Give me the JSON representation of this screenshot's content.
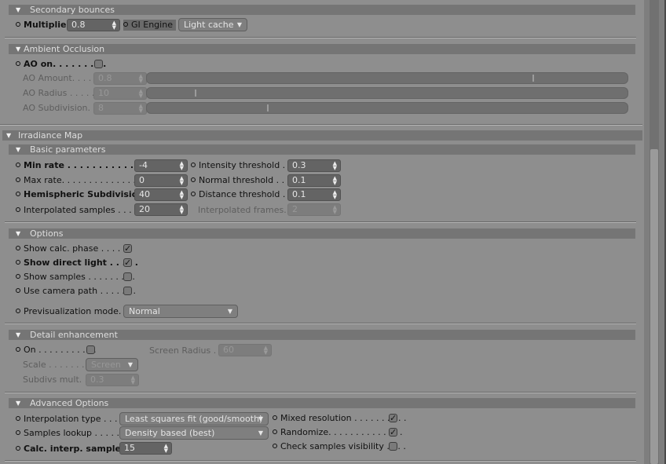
{
  "secondary_bounces": {
    "header": "Secondary bounces",
    "multiplier_label": "Multiplier",
    "multiplier_value": "0.8",
    "gi_engine_label": "GI Engine",
    "gi_engine_value": "Light cache"
  },
  "ambient_occlusion": {
    "header": "Ambient Occlusion",
    "ao_on_label": "AO on. . . . . . . . .",
    "ao_on_checked": false,
    "ao_amount_label": "AO Amount. . . . .",
    "ao_amount_value": "0.8",
    "ao_amount_slider": 0.8,
    "ao_radius_label": "AO Radius . . . . .",
    "ao_radius_value": "10",
    "ao_radius_slider": 0.1,
    "ao_subdivision_label": "AO Subdivision. . .",
    "ao_subdivision_value": "8",
    "ao_subdivision_slider": 0.25
  },
  "irradiance_map": {
    "header": "Irradiance Map",
    "basic": {
      "header": "Basic parameters",
      "min_rate_label": "Min rate . . . . . . . . . . . . . .",
      "min_rate_value": "-4",
      "max_rate_label": "Max rate. . . . . . . . . . . . . . .",
      "max_rate_value": "0",
      "hemi_label": "Hemispheric Subdivision",
      "hemi_value": "40",
      "interp_samples_label": "Interpolated samples . . . . . .",
      "interp_samples_value": "20",
      "intensity_label": "Intensity threshold . . .",
      "intensity_value": "0.3",
      "normal_label": "Normal threshold . . . .",
      "normal_value": "0.1",
      "distance_label": "Distance threshold . . .",
      "distance_value": "0.1",
      "interp_frames_label": "Interpolated frames. . .",
      "interp_frames_value": "2"
    },
    "options": {
      "header": "Options",
      "show_calc_label": "Show calc. phase . . . . . .",
      "show_calc_checked": true,
      "show_direct_label": "Show direct light . . . . .",
      "show_direct_checked": true,
      "show_samples_label": "Show samples . . . . . . . . .",
      "show_samples_checked": false,
      "camera_path_label": "Use camera path . . . . . . .",
      "camera_path_checked": false,
      "previs_label": "Previsualization mode. . . .",
      "previs_value": "Normal"
    },
    "detail": {
      "header": "Detail enhancement",
      "on_label": "On . . . . . . . . . . .",
      "on_checked": false,
      "screen_radius_label": "Screen Radius . .",
      "screen_radius_value": "60",
      "scale_label": "Scale . . . . . . . . .",
      "scale_value": "Screen",
      "subdivs_label": "Subdivs mult. . . .",
      "subdivs_value": "0.3"
    },
    "advanced": {
      "header": "Advanced Options",
      "interp_type_label": "Interpolation type . . . . . .",
      "interp_type_value": "Least squares fit (good/smooth)",
      "samples_lookup_label": "Samples lookup . . . . . . .",
      "samples_lookup_value": "Density based (best)",
      "calc_interp_label": "Calc. interp. samples",
      "calc_interp_value": "15",
      "mixed_label": "Mixed resolution . . . . . . . . . .",
      "mixed_checked": true,
      "randomize_label": "Randomize. . . . . . . . . . . . . .",
      "randomize_checked": true,
      "check_vis_label": "Check samples visibility . . . .",
      "check_vis_checked": false
    }
  },
  "icons": {
    "expand": "triangle-down-icon",
    "spinner": "spinner-arrows-icon",
    "dropdown": "dropdown-arrow-icon",
    "checkmark": "checkmark-icon"
  }
}
